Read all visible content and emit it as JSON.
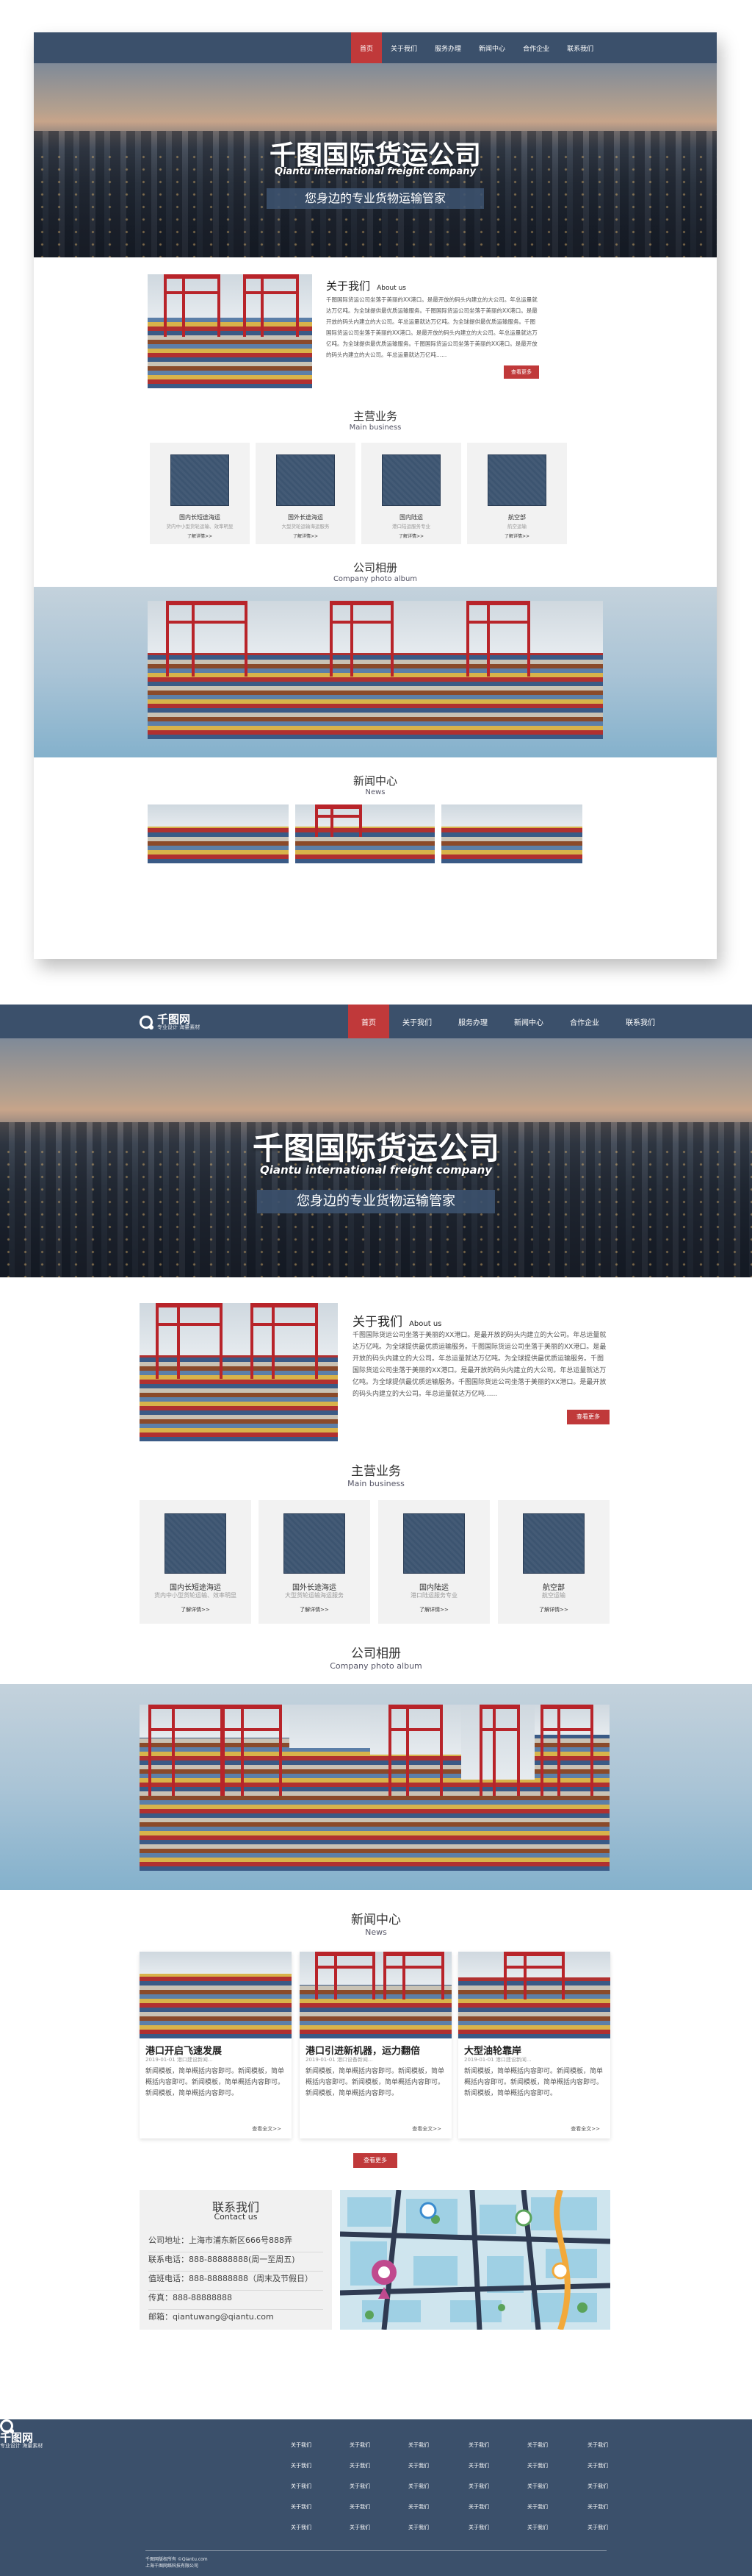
{
  "brand": {
    "logo": "千图网",
    "logo_sub": "专业设计 海量素材"
  },
  "nav": {
    "items": [
      "首页",
      "关于我们",
      "服务办理",
      "新闻中心",
      "合作企业",
      "联系我们"
    ]
  },
  "hero": {
    "title": "千图国际货运公司",
    "subtitle": "Qiantu international freight company",
    "tagline": "您身边的专业货物运输管家"
  },
  "about": {
    "title": "关于我们",
    "title_en": "About us",
    "body": "千图国际货运公司坐落于美丽的XX港口。是最开放的码头内建立的大公司。年总运量就达万亿吨。为全球提供最优质运输服务。千图国际货运公司坐落于美丽的XX港口。是最开放的码头内建立的大公司。年总运量就达万亿吨。为全球提供最优质运输服务。千图国际货运公司坐落于美丽的XX港口。是最开放的码头内建立的大公司。年总运量就达万亿吨。为全球提供最优质运输服务。千图国际货运公司坐落于美丽的XX港口。是最开放的码头内建立的大公司。年总运量就达万亿吨......",
    "button": "查看更多"
  },
  "business": {
    "title": "主营业务",
    "title_en": "Main business",
    "items": [
      {
        "title": "国内长短途海运",
        "desc": "货内中小型货轮运输、效率明显",
        "more": "了解详情>>"
      },
      {
        "title": "国外长途海运",
        "desc": "大型货轮运输海运服务",
        "more": "了解详情>>"
      },
      {
        "title": "国内陆运",
        "desc": "港口陆运服务专业",
        "more": "了解详情>>"
      },
      {
        "title": "航空部",
        "desc": "航空运输",
        "more": "了解详情>>"
      }
    ]
  },
  "album": {
    "title": "公司相册",
    "title_en": "Company photo album"
  },
  "news": {
    "title": "新闻中心",
    "title_en": "News",
    "items": [
      {
        "title": "港口开启飞速发展",
        "date": "2019-01-01 港口建设新闻...",
        "body": "新闻模板，简单概括内容即可。新闻模板，简单概括内容即可。新闻模板，简单概括内容即可。新闻模板，简单概括内容即可。",
        "more": "查看全文>>"
      },
      {
        "title": "港口引进新机器，运力翻倍",
        "date": "2019-01-01 港口设备新闻...",
        "body": "新闻模板，简单概括内容即可。新闻模板，简单概括内容即可。新闻模板，简单概括内容即可。新闻模板，简单概括内容即可。",
        "more": "查看全文>>"
      },
      {
        "title": "大型油轮靠岸",
        "date": "2019-01-01 港口建设新闻...",
        "body": "新闻模板，简单概括内容即可。新闻模板，简单概括内容即可。新闻模板，简单概括内容即可。新闻模板，简单概括内容即可。",
        "more": "查看全文>>"
      }
    ],
    "button": "查看更多"
  },
  "contact": {
    "title": "联系我们",
    "title_en": "Contact us",
    "lines": [
      "公司地址：上海市浦东新区666号888弄",
      "联系电话：888-88888888(周一至周五)",
      "值班电话：888-88888888（周末及节假日）",
      "传真：888-88888888",
      "邮箱：qiantuwang@qiantu.com"
    ]
  },
  "footer": {
    "columns": [
      [
        "关于我们",
        "关于我们",
        "关于我们",
        "关于我们",
        "关于我们"
      ],
      [
        "关于我们",
        "关于我们",
        "关于我们",
        "关于我们",
        "关于我们"
      ],
      [
        "关于我们",
        "关于我们",
        "关于我们",
        "关于我们",
        "关于我们"
      ],
      [
        "关于我们",
        "关于我们",
        "关于我们",
        "关于我们",
        "关于我们"
      ],
      [
        "关于我们",
        "关于我们",
        "关于我们",
        "关于我们",
        "关于我们"
      ],
      [
        "关于我们",
        "关于我们",
        "关于我们",
        "关于我们",
        "关于我们"
      ]
    ],
    "copy1": "千图网版权所有 ©Qiantu.com",
    "copy2": "上海千图网络科技有限公司"
  },
  "colors": {
    "navy": "#3b506b",
    "red": "#c0393a"
  }
}
